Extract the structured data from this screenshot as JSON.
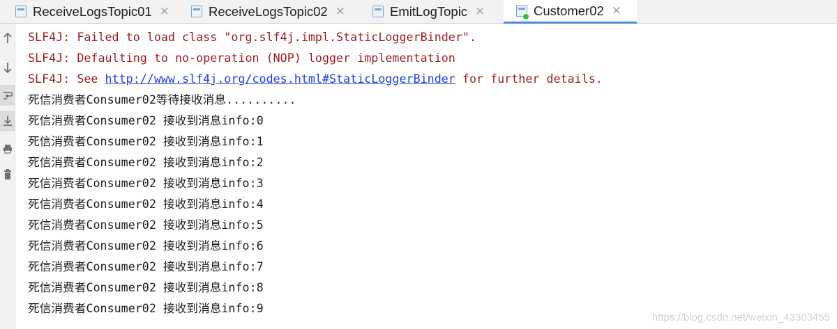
{
  "tabs": [
    {
      "label": "ReceiveLogsTopic01",
      "active": false,
      "running": false
    },
    {
      "label": "ReceiveLogsTopic02",
      "active": false,
      "running": false
    },
    {
      "label": "EmitLogTopic",
      "active": false,
      "running": false
    },
    {
      "label": "Customer02",
      "active": true,
      "running": true
    }
  ],
  "close_glyph": "×",
  "toolbar": {
    "icons": [
      "up-arrow-icon",
      "down-arrow-icon",
      "soft-wrap-icon",
      "scroll-to-end-icon",
      "print-icon",
      "trash-icon"
    ]
  },
  "console": {
    "errors": [
      {
        "text": "SLF4J: Failed to load class \"org.slf4j.impl.StaticLoggerBinder\"."
      },
      {
        "text": "SLF4J: Defaulting to no-operation (NOP) logger implementation"
      },
      {
        "prefix": "SLF4J: See ",
        "link": "http://www.slf4j.org/codes.html#StaticLoggerBinder",
        "suffix": " for further details."
      }
    ],
    "waiting": {
      "cn1": "死信消费者",
      "en": "Consumer02",
      "cn2": "等待接收消息",
      "dots": ".........."
    },
    "received": [
      {
        "cn1": "死信消费者",
        "en": "Consumer02 ",
        "cn2": "接收到消息",
        "val": "info:0"
      },
      {
        "cn1": "死信消费者",
        "en": "Consumer02 ",
        "cn2": "接收到消息",
        "val": "info:1"
      },
      {
        "cn1": "死信消费者",
        "en": "Consumer02 ",
        "cn2": "接收到消息",
        "val": "info:2"
      },
      {
        "cn1": "死信消费者",
        "en": "Consumer02 ",
        "cn2": "接收到消息",
        "val": "info:3"
      },
      {
        "cn1": "死信消费者",
        "en": "Consumer02 ",
        "cn2": "接收到消息",
        "val": "info:4"
      },
      {
        "cn1": "死信消费者",
        "en": "Consumer02 ",
        "cn2": "接收到消息",
        "val": "info:5"
      },
      {
        "cn1": "死信消费者",
        "en": "Consumer02 ",
        "cn2": "接收到消息",
        "val": "info:6"
      },
      {
        "cn1": "死信消费者",
        "en": "Consumer02 ",
        "cn2": "接收到消息",
        "val": "info:7"
      },
      {
        "cn1": "死信消费者",
        "en": "Consumer02 ",
        "cn2": "接收到消息",
        "val": "info:8"
      },
      {
        "cn1": "死信消费者",
        "en": "Consumer02 ",
        "cn2": "接收到消息",
        "val": "info:9"
      }
    ]
  },
  "watermark": "https://blog.csdn.net/weixin_43303455",
  "colors": {
    "error_text": "#9b1b1b",
    "link": "#1a3ee6",
    "active_tab_underline": "#4a8ad4",
    "running_dot": "#3fba40"
  }
}
